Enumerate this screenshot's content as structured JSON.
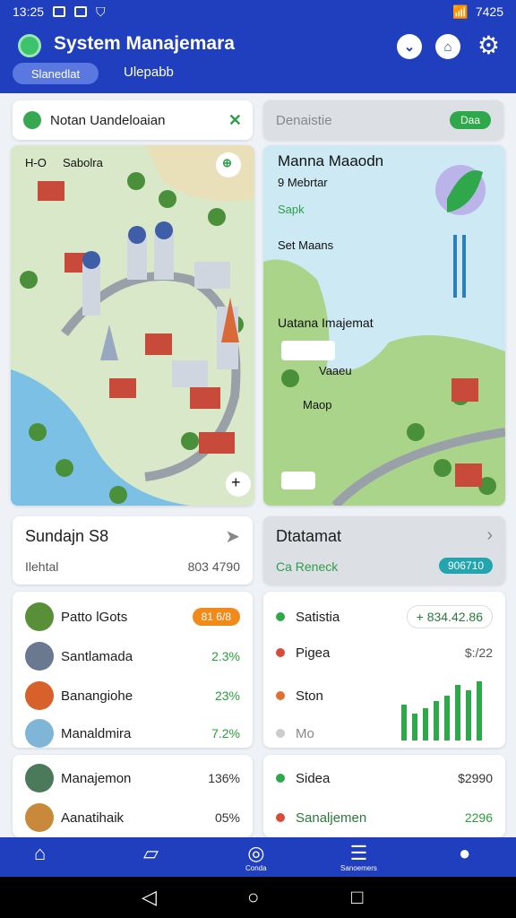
{
  "status_bar": {
    "time": "13:25",
    "right_text": "7425"
  },
  "header": {
    "title": "System Manajemara",
    "tab_active": "Slanedlat",
    "tab_other": "Ulepabb"
  },
  "search": {
    "label": "Notan Uandeloaian"
  },
  "top_right": {
    "label": "Denaistie",
    "pill": "Daa"
  },
  "map_left": {
    "label": "Sabolra",
    "corner": "H-O"
  },
  "map_right": {
    "title": "Manna Maaodn",
    "subtitle": "9 Mebrtar",
    "tag": "Sapk",
    "section": "Set Maans",
    "region": "Uatana Imajemat",
    "pin1": "Vaaeu",
    "pin2": "Maop"
  },
  "summary_left": {
    "title": "Sundajn S8",
    "sub": "Ilehtal",
    "value": "803 4790"
  },
  "summary_right": {
    "title": "Dtatamat",
    "sub": "Ca Reneck",
    "pill": "906710"
  },
  "list_left": [
    {
      "label": "Patto lGots",
      "value": "81 6/8"
    },
    {
      "label": "Santlamada",
      "value": "2.3%"
    },
    {
      "label": "Banangiohe",
      "value": "23%"
    },
    {
      "label": "Manaldmira",
      "value": "7.2%"
    }
  ],
  "list_right": [
    {
      "label": "Satistia",
      "value": "+ 834.42.86"
    },
    {
      "label": "Pigea",
      "value": "$:/22"
    },
    {
      "label": "Ston",
      "value": ""
    },
    {
      "label": "Mo",
      "value": ""
    }
  ],
  "bottom_left": [
    {
      "label": "Manajemon",
      "value": "136%"
    },
    {
      "label": "Aanatihaik",
      "value": "05%"
    }
  ],
  "bottom_right": [
    {
      "label": "Sidea",
      "value": "$2990"
    },
    {
      "label": "Sanaljemen",
      "value": "2296"
    }
  ],
  "bottom_nav": {
    "item3": "Conda",
    "item4": "Sanoemers"
  },
  "colors": {
    "primary": "#1f3fbf",
    "green": "#2ea84a",
    "orange": "#f28a1a",
    "teal": "#23a5b0"
  },
  "icons": [
    "home-icon",
    "folder-icon",
    "compass-icon",
    "list-icon",
    "user-icon",
    "gear-icon",
    "back-icon",
    "home-circle-icon",
    "recent-square-icon"
  ]
}
